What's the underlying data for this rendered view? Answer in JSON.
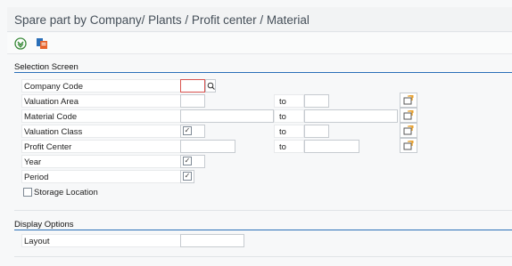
{
  "window": {
    "title": "Spare part by Company/ Plants / Profit center / Material"
  },
  "toolbar": {
    "execute_icon": "execute-icon",
    "variant_icon": "get-variant-icon"
  },
  "selection": {
    "heading": "Selection Screen",
    "fields": [
      {
        "label": "Company Code",
        "value": "",
        "kind": "single-focused"
      },
      {
        "label": "Valuation Area",
        "value": "",
        "to_label": "to",
        "to_value": "",
        "kind": "range"
      },
      {
        "label": "Material Code",
        "value": "",
        "to_label": "to",
        "to_value": "",
        "kind": "range-wide"
      },
      {
        "label": "Valuation Class",
        "value": "",
        "to_label": "to",
        "to_value": "",
        "kind": "range-check"
      },
      {
        "label": "Profit Center",
        "value": "",
        "to_label": "to",
        "to_value": "",
        "kind": "range-medium"
      },
      {
        "label": "Year",
        "value": "",
        "kind": "single-check"
      },
      {
        "label": "Period",
        "value": "",
        "kind": "single-check-small"
      }
    ],
    "storage_location": {
      "label": "Storage Location",
      "checked": false
    }
  },
  "display": {
    "heading": "Display Options",
    "layout": {
      "label": "Layout",
      "value": ""
    }
  },
  "colors": {
    "accent": "#2a6fb8",
    "focus": "#d9534f"
  }
}
